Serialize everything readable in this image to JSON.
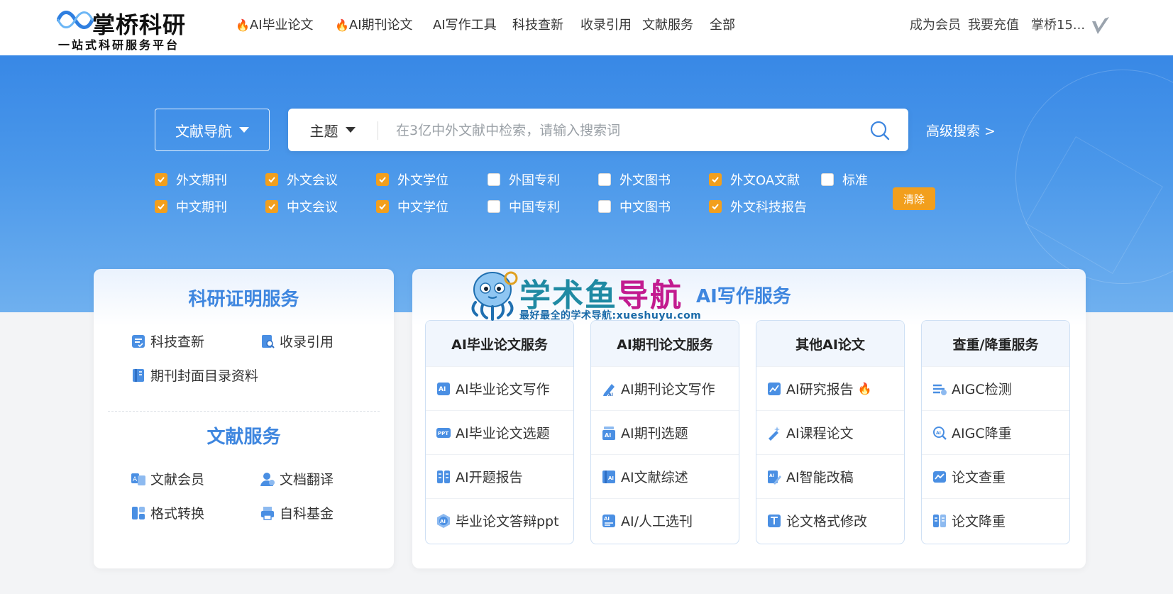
{
  "header": {
    "logo_name": "掌桥科研",
    "logo_slogan": "一站式科研服务平台",
    "nav": [
      {
        "label": "AI毕业论文",
        "fire": true
      },
      {
        "label": "AI期刊论文",
        "fire": true
      },
      {
        "label": "AI写作工具",
        "fire": false
      },
      {
        "label": "科技查新",
        "fire": false
      },
      {
        "label": "收录引用",
        "fire": false
      },
      {
        "label": "文献服务",
        "fire": false
      },
      {
        "label": "全部",
        "fire": false
      }
    ],
    "user_nav": [
      "成为会员",
      "我要充值",
      "掌桥15..."
    ],
    "fire_glyph": "🔥"
  },
  "search": {
    "nav_button_label": "文献导航",
    "type_label": "主题",
    "placeholder": "在3亿中外文献中检索，请输入搜索词",
    "advanced_label": "高级搜索 >",
    "clear_label": "清除"
  },
  "filters": {
    "row1": [
      {
        "label": "外文期刊",
        "checked": true
      },
      {
        "label": "外文会议",
        "checked": true
      },
      {
        "label": "外文学位",
        "checked": true
      },
      {
        "label": "外国专利",
        "checked": false
      },
      {
        "label": "外文图书",
        "checked": false
      },
      {
        "label": "外文OA文献",
        "checked": true
      },
      {
        "label": "标准",
        "checked": false
      }
    ],
    "row2": [
      {
        "label": "中文期刊",
        "checked": true
      },
      {
        "label": "中文会议",
        "checked": true
      },
      {
        "label": "中文学位",
        "checked": true
      },
      {
        "label": "中国专利",
        "checked": false
      },
      {
        "label": "中文图书",
        "checked": false
      },
      {
        "label": "外文科技报告",
        "checked": true
      }
    ]
  },
  "research_proof": {
    "title": "科研证明服务",
    "links": [
      "科技查新",
      "收录引用",
      "期刊封面目录资料"
    ]
  },
  "literature_service": {
    "title": "文献服务",
    "links": [
      "文献会员",
      "文档翻译",
      "格式转换",
      "自科基金"
    ]
  },
  "ai_writing": {
    "title": "AI写作服务",
    "columns": [
      {
        "title": "AI毕业论文服务",
        "items": [
          "AI毕业论文写作",
          "AI毕业论文选题",
          "AI开题报告",
          "毕业论文答辩ppt"
        ]
      },
      {
        "title": "AI期刊论文服务",
        "items": [
          "AI期刊论文写作",
          "AI期刊选题",
          "AI文献综述",
          "AI/人工选刊"
        ]
      },
      {
        "title": "其他AI论文",
        "items": [
          "AI研究报告",
          "AI课程论文",
          "AI智能改稿",
          "论文格式修改"
        ]
      },
      {
        "title": "查重/降重服务",
        "items": [
          "AIGC检测",
          "AIGC降重",
          "论文查重",
          "论文降重"
        ]
      }
    ]
  },
  "watermark": {
    "text_part1": "学术鱼",
    "text_part2": "导航",
    "subtitle": "最好最全的学术导航:xueshuyu.com"
  },
  "colors": {
    "accent_blue": "#3e86df",
    "hero_blue": "#3888e6",
    "checkbox_orange": "#f29f1d",
    "fire_orange": "#f06a1d"
  }
}
